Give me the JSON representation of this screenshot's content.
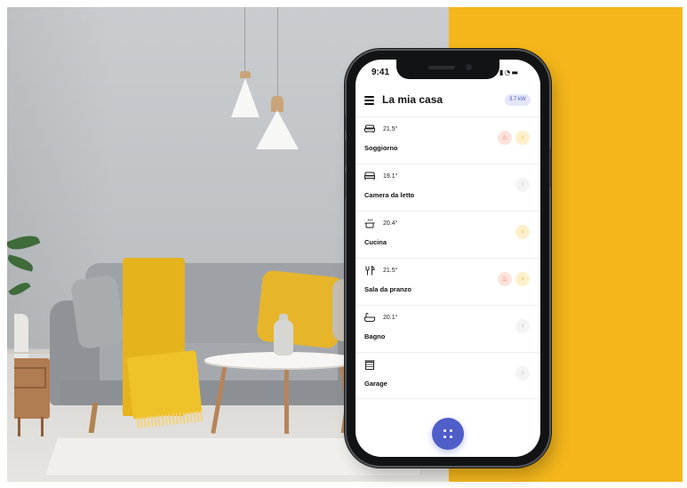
{
  "status_bar": {
    "time": "9:41",
    "signal_icon": "cellular-signal-icon",
    "wifi_icon": "wifi-icon",
    "battery_icon": "battery-icon"
  },
  "app_bar": {
    "menu_icon": "hamburger-menu-icon",
    "title": "La mia casa",
    "power_badge": "3.7 kW"
  },
  "rooms": [
    {
      "name": "Soggiorno",
      "temperature": "21.5°",
      "icon": "sofa-icon",
      "heating": true,
      "light_on": true
    },
    {
      "name": "Camera da letto",
      "temperature": "19.1°",
      "icon": "bed-icon",
      "heating": false,
      "light_on": false
    },
    {
      "name": "Cucina",
      "temperature": "20.4°",
      "icon": "cooking-pot-icon",
      "heating": false,
      "light_on": true
    },
    {
      "name": "Sala da pranzo",
      "temperature": "21.5°",
      "icon": "fork-knife-icon",
      "heating": true,
      "light_on": true
    },
    {
      "name": "Bagno",
      "temperature": "20.1°",
      "icon": "bathtub-icon",
      "heating": false,
      "light_on": false
    },
    {
      "name": "Garage",
      "temperature": "",
      "icon": "garage-icon",
      "heating": false,
      "light_on": false
    }
  ],
  "fab": {
    "icon": "grid-dots-icon"
  },
  "colors": {
    "accent": "#4f5ec8",
    "background_panel": "#f4b61b",
    "heating": "#ef5a3a",
    "light_on": "#efb324",
    "light_off": "#c2c2c2"
  }
}
